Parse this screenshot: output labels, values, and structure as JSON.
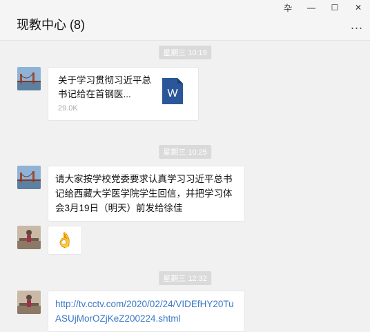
{
  "window": {
    "title": "现教中心 (8)",
    "controls": {
      "pin": "卆",
      "minimize": "—",
      "maximize": "☐",
      "close": "✕"
    },
    "more": "..."
  },
  "messages": [
    {
      "type": "timestamp",
      "text": "星期三 10:19"
    },
    {
      "type": "file",
      "sender_avatar": "avatar-bridge",
      "file_name": "关于学习贯彻习近平总书记给在首钢医...",
      "file_size": "29.0K",
      "file_icon": "word-file-icon",
      "file_icon_color": "#2b579a"
    },
    {
      "type": "timestamp",
      "text": "星期三 10:25"
    },
    {
      "type": "text",
      "sender_avatar": "avatar-bridge",
      "text": "请大家按学校党委要求认真学习习近平总书记给西藏大学医学院学生回信，并把学习体会3月19日（明天）前发给徐佳"
    },
    {
      "type": "emoji",
      "sender_avatar": "avatar-person",
      "emoji": "👌"
    },
    {
      "type": "timestamp",
      "text": "星期三 12:32"
    },
    {
      "type": "link",
      "sender_avatar": "avatar-person",
      "text": "http://tv.cctv.com/2020/02/24/VIDEfHY20TuASUjMorOZjKeZ200224.shtml"
    }
  ]
}
